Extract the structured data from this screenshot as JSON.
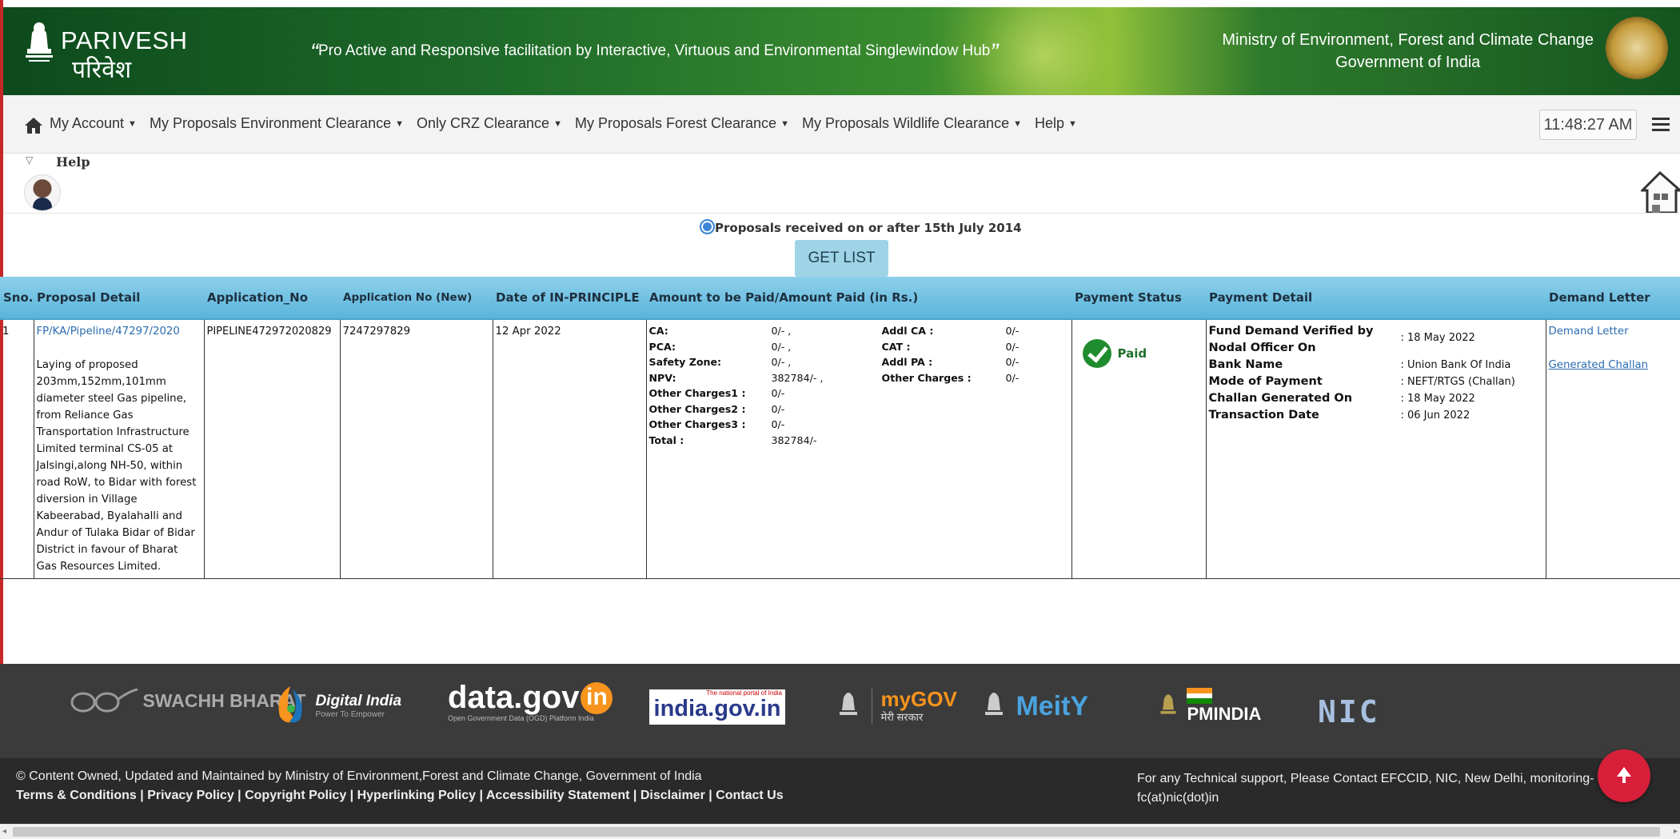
{
  "header": {
    "logo_en": "PARIVESH",
    "logo_hi": "परिवेश",
    "tagline": "Pro Active and Responsive facilitation by Interactive, Virtuous and Environmental Singlewindow Hub",
    "ministry_line1": "Ministry of Environment, Forest and Climate Change",
    "ministry_line2": "Government of India"
  },
  "nav": {
    "items": [
      {
        "label": "My Account",
        "icon": "caret-down"
      },
      {
        "label": "My Proposals Environment Clearance",
        "icon": "caret-down"
      },
      {
        "label": "Only CRZ Clearance",
        "icon": "caret-down"
      },
      {
        "label": "My Proposals Forest Clearance",
        "icon": "caret-down"
      },
      {
        "label": "My Proposals Wildlife Clearance",
        "icon": "caret-down"
      },
      {
        "label": "Help",
        "icon": "caret-down"
      }
    ],
    "clock": "11:48:27 AM",
    "home_icon": "home-icon",
    "menu_icon": "hamburger-icon"
  },
  "help": {
    "toggle": "▽",
    "label": "Help"
  },
  "filter": {
    "radio_label": "Proposals received on or after 15th July 2014",
    "button": "GET LIST"
  },
  "table": {
    "headers": [
      "Sno.",
      "Proposal Detail",
      "Application_No",
      "Application No (New)",
      "Date of IN-PRINCIPLE",
      "Amount to be Paid/Amount Paid (in Rs.)",
      "Payment Status",
      "Payment Detail",
      "Demand Letter"
    ],
    "row": {
      "sno": "1",
      "proposal_id": "FP/KA/Pipeline/47297/2020",
      "proposal_text": "Laying of proposed 203mm,152mm,101mm diameter steel Gas pipeline, from Reliance Gas Transportation Infrastructure Limited terminal CS-05 at Jalsingi,along NH-50, within road RoW, to Bidar with forest diversion in Village Kabeerabad, Byalahalli and Andur of Tulaka Bidar of Bidar District in favour of Bharat Gas Resources Limited.",
      "application_no": "PIPELINE472972020829",
      "application_no_new": "7247297829",
      "date_in_principle": "12 Apr 2022",
      "amounts": [
        {
          "label": "CA:",
          "value": "0/- ,",
          "label2": "Addl CA :",
          "value2": "0/-"
        },
        {
          "label": "PCA:",
          "value": "0/- ,",
          "label2": "CAT :",
          "value2": "0/-"
        },
        {
          "label": "Safety Zone:",
          "value": "0/- ,",
          "label2": "Addl PA :",
          "value2": "0/-"
        },
        {
          "label": "NPV:",
          "value": "382784/- ,",
          "label2": "Other Charges :",
          "value2": "0/-"
        },
        {
          "label": "Other Charges1 :",
          "value": "0/-",
          "label2": "",
          "value2": ""
        },
        {
          "label": "Other Charges2 :",
          "value": "0/-",
          "label2": "",
          "value2": ""
        },
        {
          "label": "Other Charges3 :",
          "value": "0/-",
          "label2": "",
          "value2": ""
        },
        {
          "label": "Total :",
          "value": "382784/-",
          "label2": "",
          "value2": ""
        }
      ],
      "payment_status": "Paid",
      "payment_detail": [
        {
          "label": "Fund Demand Verified by Nodal Officer On",
          "value": ": 18 May 2022"
        },
        {
          "label": "Bank Name",
          "value": ": Union Bank Of India"
        },
        {
          "label": "Mode of Payment",
          "value": ": NEFT/RTGS (Challan)"
        },
        {
          "label": "Challan Generated On",
          "value": ": 18 May 2022"
        },
        {
          "label": "Transaction Date",
          "value": ": 06 Jun 2022"
        }
      ],
      "demand_letter": "Demand Letter",
      "generated_challan": "Generated Challan"
    }
  },
  "footer_logos": {
    "swachh": "SWACHH BHARAT",
    "digital_india": "Digital India",
    "digital_india_sub": "Power To Empower",
    "datagov": "data.gov",
    "datagov_in": "in",
    "datagov_sub": "Open Government Data (OGD) Platform India",
    "indiagov_top": "The national portal of India",
    "indiagov": "india.gov.in",
    "mygov": "myGOV",
    "mygov_sub": "मेरी सरकार",
    "meity": "MeitY",
    "pmindia": "PMINDIA",
    "nic": "NIC"
  },
  "footer": {
    "copyright": "© Content Owned, Updated and Maintained by Ministry of Environment,Forest and Climate Change, Government of India",
    "links": [
      "Terms & Conditions",
      "Privacy Policy",
      "Copyright Policy",
      "Hyperlinking Policy",
      "Accessibility Statement",
      "Disclaimer",
      "Contact Us"
    ],
    "support": "For any Technical support, Please Contact EFCCID, NIC, New Delhi, monitoring-fc(at)nic(dot)in"
  },
  "colors": {
    "header_green": "#1f6b2a",
    "table_header_blue": "#5ab4dc",
    "button_blue": "#9fd4e6",
    "paid_green": "#1f8c2e",
    "footer_dark": "#2a2a2a",
    "scroll_top_red": "#d81f3a"
  }
}
